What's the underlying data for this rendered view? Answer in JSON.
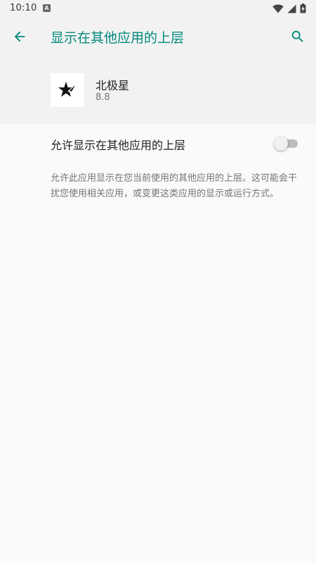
{
  "status_bar": {
    "time": "10:10",
    "notification_icon": "a-icon",
    "icons": [
      "wifi-icon",
      "signal-icon",
      "battery-charging-icon"
    ]
  },
  "app_bar": {
    "title": "显示在其他应用的上层",
    "back_icon": "arrow-back-icon",
    "search_icon": "search-icon"
  },
  "app_info": {
    "name": "北极星",
    "version": "8.8",
    "icon": "star-logo-icon"
  },
  "setting": {
    "label": "允许显示在其他应用的上层",
    "enabled": false
  },
  "description": "允许此应用显示在您当前使用的其他应用的上层。这可能会干扰您使用相关应用，或变更这类应用的显示或运行方式。",
  "colors": {
    "accent": "#00897b",
    "background": "#fafafa",
    "header_background": "#f2f2f2",
    "toggle_track_off": "#bdbdbd"
  }
}
